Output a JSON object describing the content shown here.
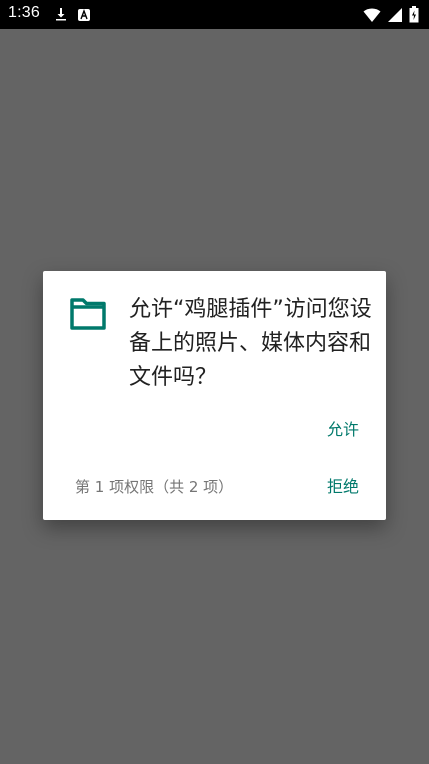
{
  "status_bar": {
    "time": "1:36",
    "left_icons": [
      "download-icon",
      "a-icon"
    ],
    "right_icons": [
      "wifi-icon",
      "signal-icon",
      "battery-icon"
    ]
  },
  "dialog": {
    "icon": "folder-icon",
    "message": "允许“鸡腿插件”访问您设备上的照片、媒体内容和文件吗？",
    "allow_label": "允许",
    "permission_count": "第 1 项权限（共 2 项）",
    "deny_label": "拒绝",
    "accent_color": "#00796b"
  }
}
